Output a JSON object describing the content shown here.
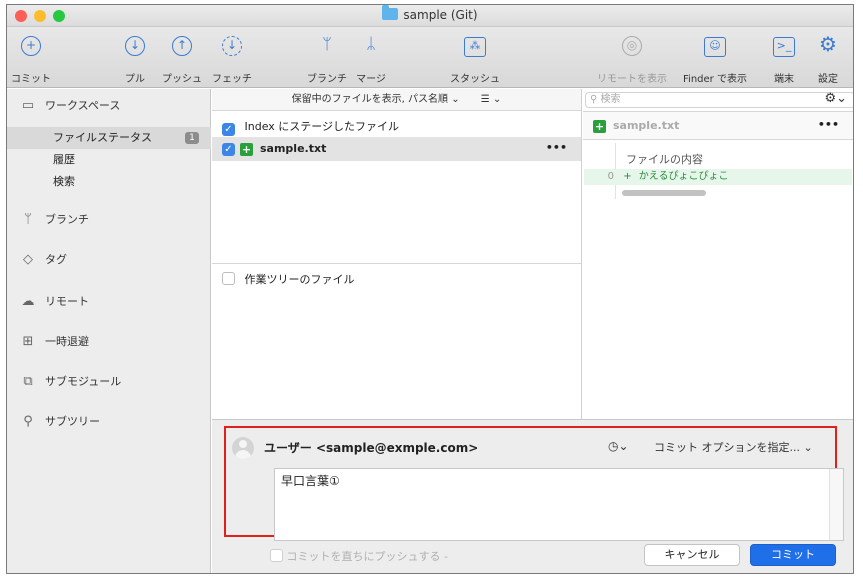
{
  "window": {
    "title": "sample (Git)"
  },
  "colors": {
    "accent": "#3b7bd0",
    "close": "#fc5f57",
    "minimize": "#fdbc2e",
    "zoom": "#28c940",
    "added": "#2aa03c",
    "highlight": "#e0201a",
    "commit_button": "#1f6fe8"
  },
  "toolbar": {
    "items": [
      {
        "label": "コミット",
        "icon": "plus-circle-icon"
      },
      {
        "label": "プル",
        "icon": "arrow-down-circle-icon"
      },
      {
        "label": "プッシュ",
        "icon": "arrow-up-circle-icon"
      },
      {
        "label": "フェッチ",
        "icon": "fetch-circle-icon"
      },
      {
        "label": "ブランチ",
        "icon": "branch-icon"
      },
      {
        "label": "マージ",
        "icon": "merge-icon"
      },
      {
        "label": "スタッシュ",
        "icon": "stash-icon"
      },
      {
        "label": "リモートを表示",
        "icon": "globe-icon"
      },
      {
        "label": "Finder で表示",
        "icon": "finder-icon"
      },
      {
        "label": "端末",
        "icon": "terminal-icon"
      },
      {
        "label": "設定",
        "icon": "gear-icon"
      }
    ]
  },
  "sidebar": {
    "workspace": "ワークスペース",
    "sub_items": [
      {
        "label": "ファイルステータス",
        "badge": "1"
      },
      {
        "label": "履歴"
      },
      {
        "label": "検索"
      }
    ],
    "sections": [
      {
        "label": "ブランチ",
        "icon": "branch-icon"
      },
      {
        "label": "タグ",
        "icon": "tag-icon"
      },
      {
        "label": "リモート",
        "icon": "cloud-icon"
      },
      {
        "label": "一時退避",
        "icon": "stash-icon"
      },
      {
        "label": "サブモジュール",
        "icon": "submodule-icon"
      },
      {
        "label": "サブツリー",
        "icon": "subtree-icon"
      }
    ]
  },
  "filelist": {
    "sort_label": "保留中のファイルを表示, パス名順 ⌄",
    "view_menu": "☰ ⌄",
    "staged_header": "Index にステージしたファイル",
    "staged_files": [
      {
        "name": "sample.txt",
        "more": "•••"
      }
    ],
    "unstaged_header": "作業ツリーのファイル"
  },
  "search": {
    "placeholder": "検索"
  },
  "diff": {
    "filename": "sample.txt",
    "more": "•••",
    "hunk_header": "ファイルの内容",
    "lines": [
      {
        "num": "0",
        "sign": "+",
        "text": "かえるぴょこぴょこ"
      }
    ]
  },
  "commit": {
    "author": "ユーザー <sample@exmple.com>",
    "options": "コミット オプションを指定... ⌄",
    "message": "早口言葉①",
    "push_label": "コミットを直ちにプッシュする -",
    "cancel": "キャンセル",
    "submit": "コミット"
  }
}
